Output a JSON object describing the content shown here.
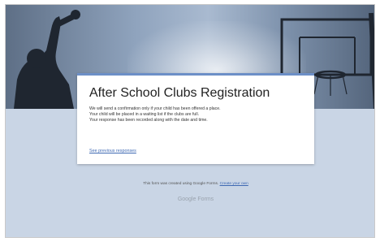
{
  "form": {
    "title": "After School Clubs Registration",
    "messages": [
      "We will send a confirmation only if your child has been offered a place.",
      "Your child will be placed in a waiting list if the clubs are full.",
      "Your response has been recorded along with the date and time."
    ],
    "previous_responses_link": "See previous responses"
  },
  "footer": {
    "created_text": "This form was created using Google Forms.",
    "create_own_link": "Create your own",
    "brand": "Google Forms"
  },
  "colors": {
    "accent": "#6c8fc7",
    "link": "#3e69b3",
    "page_background": "#c9d5e5"
  }
}
